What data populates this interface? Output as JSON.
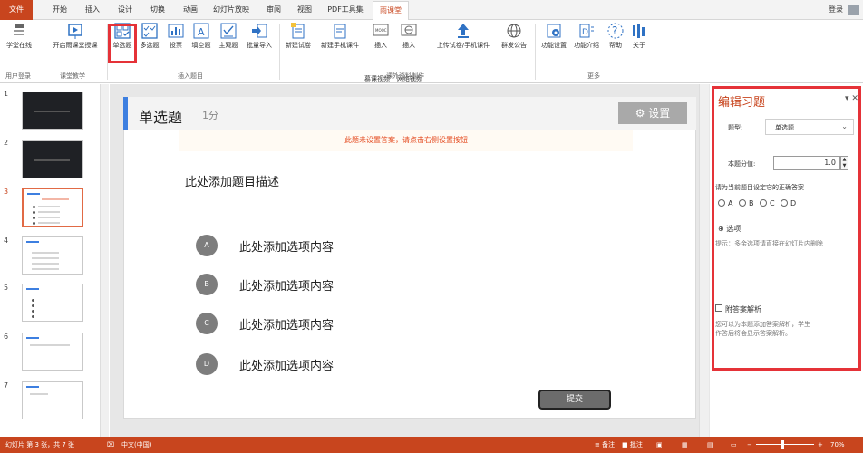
{
  "tabs": [
    "文件",
    "开始",
    "插入",
    "设计",
    "切换",
    "动画",
    "幻灯片放映",
    "审阅",
    "视图",
    "PDF工具集",
    "雨课堂"
  ],
  "login": "登录",
  "ribbon": {
    "buttons": {
      "xuetang": "学堂在线",
      "kaiqi": "开启雨课堂授课",
      "danxuan": "单选题",
      "duoxuan": "多选题",
      "toupiao": "投票",
      "tiankong": "填空题",
      "zhuguan": "主观题",
      "piliang": "批量导入",
      "xinjianshijuan": "新建试卷",
      "xinjianshouji": "新建手机课件",
      "charu_mooc": "插入",
      "charu_mooc2": "慕课视频",
      "charu_net": "插入",
      "charu_net2": "网络视频",
      "shangchuan": "上传试卷/手机课件",
      "qunfa": "群发公告",
      "gongneng": "功能设置",
      "jieshao": "功能介绍",
      "bangzhu": "帮助",
      "guanyu": "关于"
    },
    "groups": {
      "user": "用户登录",
      "teach": "课堂教学",
      "insert": "插入题目",
      "extra": "课外资料制作",
      "more": "更多"
    }
  },
  "thumbs": [
    "1",
    "2",
    "3",
    "4",
    "5",
    "6",
    "7"
  ],
  "slide": {
    "title": "单选题",
    "score": "1分",
    "settings": "设置",
    "warning": "此题未设置答案，请点击右侧设置按钮",
    "description": "此处添加题目描述",
    "options": [
      {
        "letter": "A",
        "text": "此处添加选项内容"
      },
      {
        "letter": "B",
        "text": "此处添加选项内容"
      },
      {
        "letter": "C",
        "text": "此处添加选项内容"
      },
      {
        "letter": "D",
        "text": "此处添加选项内容"
      }
    ],
    "submit": "提交"
  },
  "panel": {
    "title": "编辑习题",
    "type_label": "题型:",
    "type_value": "单选题",
    "score_label": "本题分值:",
    "score_value": "1.0",
    "answer_label": "请为当前题目设定它的正确答案",
    "answers": [
      "A",
      "B",
      "C",
      "D"
    ],
    "add_option": "选项",
    "add_hint": "提示：多余选项请直接在幻灯片内删除",
    "analysis_label": "附答案解析",
    "analysis_hint1": "您可以为本题添加答案解析，学生",
    "analysis_hint2": "作答后将会显示答案解析。"
  },
  "status": {
    "slide": "幻灯片 第 3 张，共 7 张",
    "lang": "中文(中国)",
    "notes": "备注",
    "comments": "批注",
    "zoom": "70%"
  },
  "colors": {
    "accent": "#c8451e",
    "highlight": "#e53238",
    "bar": "#3d7fe0"
  }
}
